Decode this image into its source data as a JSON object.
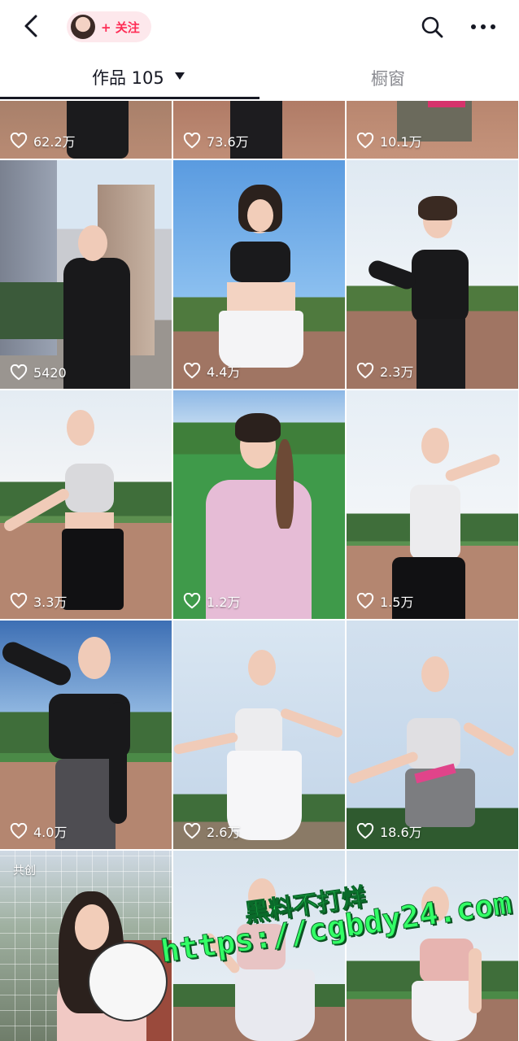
{
  "header": {
    "follow_label": "+ 关注",
    "icons": [
      "back-icon",
      "search-icon",
      "more-icon"
    ]
  },
  "tabs": {
    "works_label": "作品 105",
    "window_label": "橱窗"
  },
  "grid": {
    "tiles": [
      {
        "likes": "62.2万"
      },
      {
        "likes": "73.6万"
      },
      {
        "likes": "10.1万"
      },
      {
        "likes": "5420"
      },
      {
        "likes": "4.4万"
      },
      {
        "likes": "2.3万"
      },
      {
        "likes": "3.3万"
      },
      {
        "likes": "1.2万"
      },
      {
        "likes": "1.5万"
      },
      {
        "likes": "4.0万"
      },
      {
        "likes": "2.6万"
      },
      {
        "likes": "18.6万"
      },
      {
        "tag": "共创"
      },
      {},
      {}
    ]
  },
  "watermark": {
    "line1": "黑料不打烊",
    "line2": "https://cgbdy24.com"
  },
  "colors": {
    "accent": "#fe2c55",
    "follow_bg": "#fde8ec",
    "text_primary": "#161823",
    "text_secondary": "#8a8b91",
    "watermark": "#33ff66"
  }
}
